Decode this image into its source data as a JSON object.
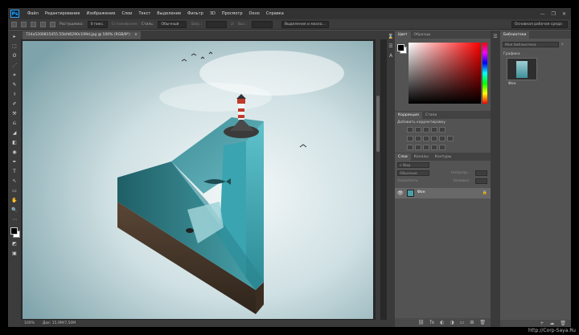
{
  "app": {
    "logo": "Ps"
  },
  "menu": [
    "Файл",
    "Редактирование",
    "Изображение",
    "Слои",
    "Текст",
    "Выделение",
    "Фильтр",
    "3D",
    "Просмотр",
    "Окно",
    "Справка"
  ],
  "window_controls": [
    "—",
    "❐",
    "✕"
  ],
  "options": {
    "feather_label": "Растушевка:",
    "feather_value": "0 пикс.",
    "smooth_label": "Сглаживание",
    "style_label": "Стиль:",
    "style_value": "Обычный",
    "width_label": "Шир.:",
    "height_label": "Выс.:",
    "refine_button": "Выделение и маска...",
    "workspace": "Основная рабочая среда"
  },
  "document": {
    "tab_title": "724a5200815455.55bfd6290c199d.jpg @ 100% (RGB/8*)",
    "tab_close": "×",
    "status_zoom": "100%",
    "status_doc": "Док: 15,9M/7,50M"
  },
  "color_panel": {
    "tabs": [
      "Цвет",
      "Образцы"
    ]
  },
  "adjustments_panel": {
    "tabs": [
      "Коррекция",
      "Стили"
    ],
    "subtitle": "Добавить корректировку"
  },
  "layers_panel": {
    "tabs": [
      "Слои",
      "Каналы",
      "Контуры"
    ],
    "search_placeholder": "Вид",
    "blend_mode": "Обычные",
    "opacity_label": "Непрозр.:",
    "lock_label": "Закрепить:",
    "fill_label": "Заливка:",
    "layer_name": "Фон",
    "bottom_icons": [
      "⛓",
      "fx",
      "◐",
      "◑",
      "▭",
      "⊞",
      "🗑"
    ]
  },
  "library_panel": {
    "tab": "Библиотеки",
    "selector": "Моя библиотека",
    "section": "Графика",
    "item_name": "Фон"
  },
  "tools": [
    "▸",
    "⬚",
    "ʘ",
    "⋰",
    "⌗",
    "✎",
    "⚕",
    "✐",
    "⚒",
    "⎌",
    "◢",
    "◧",
    "◉",
    "✒",
    "T",
    "↖",
    "▭",
    "✋",
    "🔍",
    "⋯",
    "◩",
    "▣",
    "▢"
  ],
  "colors": {
    "accent": "#31a8ff",
    "panel_bg": "#535353",
    "dark_bg": "#323232"
  },
  "watermark": "http://Corp-Saya.Ru"
}
